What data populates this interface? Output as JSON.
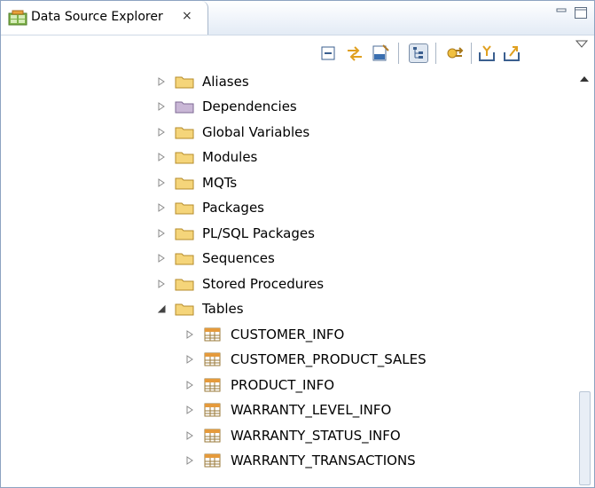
{
  "view": {
    "tab_title": "Data Source Explorer",
    "tab_close_glyph": "×"
  },
  "toolbar": {
    "buttons": [
      {
        "icon": "collapse-all-icon",
        "pressed": false
      },
      {
        "icon": "link-with-editor-icon",
        "pressed": false
      },
      {
        "icon": "open-sql-script-icon",
        "pressed": false
      },
      {
        "icon": "show-tree-icon",
        "pressed": true
      },
      {
        "icon": "refresh-connection-icon",
        "pressed": false
      },
      {
        "icon": "import-icon",
        "pressed": false
      },
      {
        "icon": "export-icon",
        "pressed": false
      }
    ]
  },
  "tree": {
    "folders": [
      {
        "label": "Aliases",
        "expanded": false,
        "icon": "folder-icon"
      },
      {
        "label": "Dependencies",
        "expanded": false,
        "icon": "dependencies-folder-icon"
      },
      {
        "label": "Global Variables",
        "expanded": false,
        "icon": "folder-icon"
      },
      {
        "label": "Modules",
        "expanded": false,
        "icon": "folder-icon"
      },
      {
        "label": "MQTs",
        "expanded": false,
        "icon": "folder-icon"
      },
      {
        "label": "Packages",
        "expanded": false,
        "icon": "folder-icon"
      },
      {
        "label": "PL/SQL Packages",
        "expanded": false,
        "icon": "folder-icon"
      },
      {
        "label": "Sequences",
        "expanded": false,
        "icon": "folder-icon"
      },
      {
        "label": "Stored Procedures",
        "expanded": false,
        "icon": "folder-icon"
      },
      {
        "label": "Tables",
        "expanded": true,
        "icon": "folder-icon"
      }
    ],
    "tables": [
      {
        "label": "CUSTOMER_INFO",
        "icon": "table-icon"
      },
      {
        "label": "CUSTOMER_PRODUCT_SALES",
        "icon": "table-icon"
      },
      {
        "label": "PRODUCT_INFO",
        "icon": "table-icon"
      },
      {
        "label": "WARRANTY_LEVEL_INFO",
        "icon": "table-icon"
      },
      {
        "label": "WARRANTY_STATUS_INFO",
        "icon": "table-icon"
      },
      {
        "label": "WARRANTY_TRANSACTIONS",
        "icon": "table-icon"
      }
    ]
  },
  "colors": {
    "folder": "#f5d57a",
    "dependencies_folder": "#c9b7d6",
    "table_header": "#e59a3b",
    "expander": "#8a8a8a",
    "accent": "#8da3c1"
  }
}
